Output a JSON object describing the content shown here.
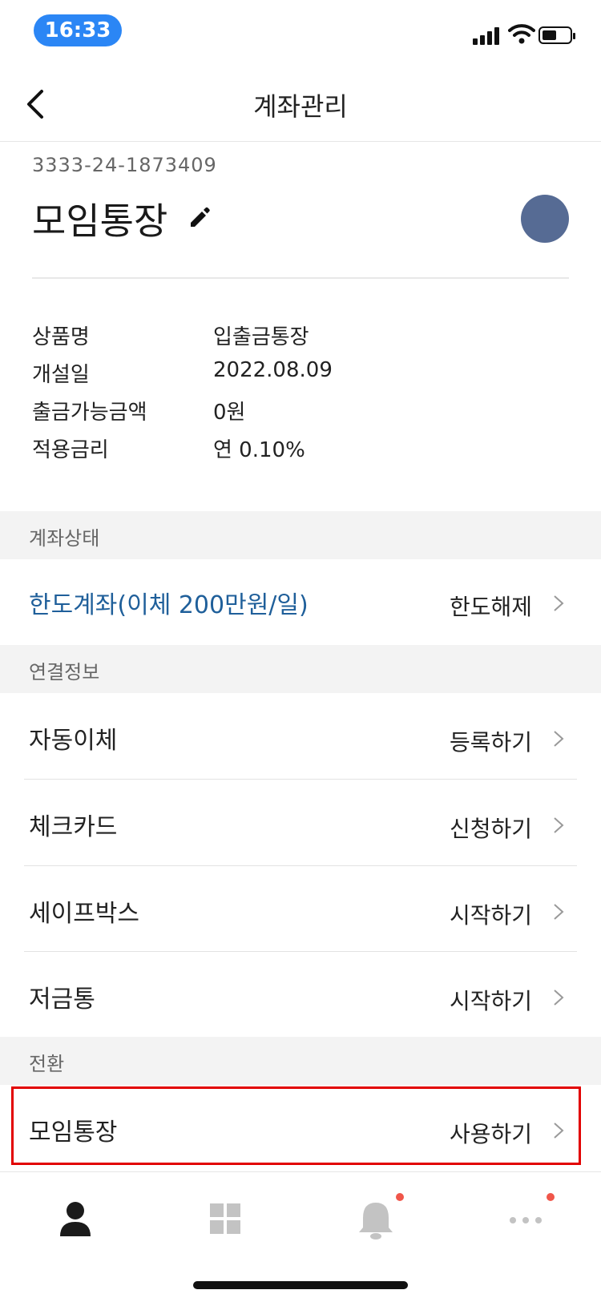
{
  "status_bar": {
    "time": "16:33"
  },
  "header": {
    "title": "계좌관리"
  },
  "account": {
    "number": "3333-24-1873409",
    "name": "모임통장",
    "avatar_color": "#566b94"
  },
  "details": [
    {
      "label": "상품명",
      "value": "입출금통장"
    },
    {
      "label": "개설일",
      "value": "2022.08.09"
    },
    {
      "label": "출금가능금액",
      "value": "0원"
    },
    {
      "label": "적용금리",
      "value": "연 0.10%"
    }
  ],
  "account_status": {
    "section_title": "계좌상태",
    "label": "한도계좌(이체 200만원/일)",
    "label_color": "#1f5f9a",
    "action": "한도해제"
  },
  "linked_info": {
    "section_title": "연결정보",
    "items": [
      {
        "label": "자동이체",
        "action": "등록하기"
      },
      {
        "label": "체크카드",
        "action": "신청하기"
      },
      {
        "label": "세이프박스",
        "action": "시작하기"
      },
      {
        "label": "저금통",
        "action": "시작하기"
      }
    ]
  },
  "conversion": {
    "section_title": "전환",
    "items": [
      {
        "label": "모임통장",
        "action": "사용하기"
      }
    ]
  },
  "tab_bar": {
    "items": [
      "person-icon",
      "grid-icon",
      "bell-icon",
      "more-icon"
    ],
    "notification_color": "#f0564a"
  },
  "colors": {
    "highlight_border": "#e20000",
    "section_bg": "#f3f3f3"
  }
}
